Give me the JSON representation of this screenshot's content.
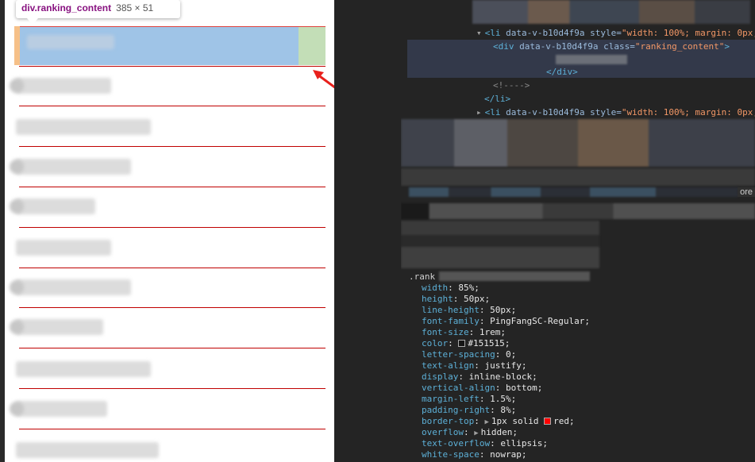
{
  "tooltip": {
    "tag": "div.ranking_content",
    "dims": "385 × 51"
  },
  "elements_panel": {
    "lines": [
      {
        "tag_open": "<li",
        "attr": " data-v-b10d4f9a",
        "attr2": " style=",
        "val": "\"width: 100%; margin: 0px;"
      },
      {
        "tag_open": "<div",
        "attr": " data-v-b10d4f9a",
        "attr2": " class=",
        "val": "\"ranking_content\"",
        "close": ">"
      },
      {
        "tag_close": "</div>"
      },
      {
        "comment": "<!---->"
      },
      {
        "tag_close": "</li>"
      },
      {
        "tag_open": "<li",
        "attr": " data-v-b10d4f9a",
        "attr2": " style=",
        "val": "\"width: 100%; margin: 0px;"
      }
    ]
  },
  "styles_panel": {
    "selector": ".rank",
    "more_label": "ore",
    "declarations": [
      {
        "prop": "width",
        "value": "85%;"
      },
      {
        "prop": "height",
        "value": "50px;"
      },
      {
        "prop": "line-height",
        "value": "50px;"
      },
      {
        "prop": "font-family",
        "value": "PingFangSC-Regular;"
      },
      {
        "prop": "font-size",
        "value": "1rem;"
      },
      {
        "prop": "color",
        "value": "#151515;",
        "swatch": "#151515"
      },
      {
        "prop": "letter-spacing",
        "value": "0;"
      },
      {
        "prop": "text-align",
        "value": "justify;"
      },
      {
        "prop": "display",
        "value": "inline-block;"
      },
      {
        "prop": "vertical-align",
        "value": "bottom;"
      },
      {
        "prop": "margin-left",
        "value": "1.5%;"
      },
      {
        "prop": "padding-right",
        "value": "8%;"
      },
      {
        "prop": "border-top",
        "value_pre": "1px solid ",
        "value": "red;",
        "swatch": "#ff0000",
        "expandable": true
      },
      {
        "prop": "overflow",
        "value": "hidden;",
        "expandable": true
      },
      {
        "prop": "text-overflow",
        "value": "ellipsis;"
      },
      {
        "prop": "white-space",
        "value": "nowrap;"
      }
    ]
  },
  "colors": {
    "highlight_content": "#9fc4e7",
    "highlight_padding": "#c3deb7",
    "highlight_margin": "#f6c088",
    "row_border": "#c00000"
  }
}
